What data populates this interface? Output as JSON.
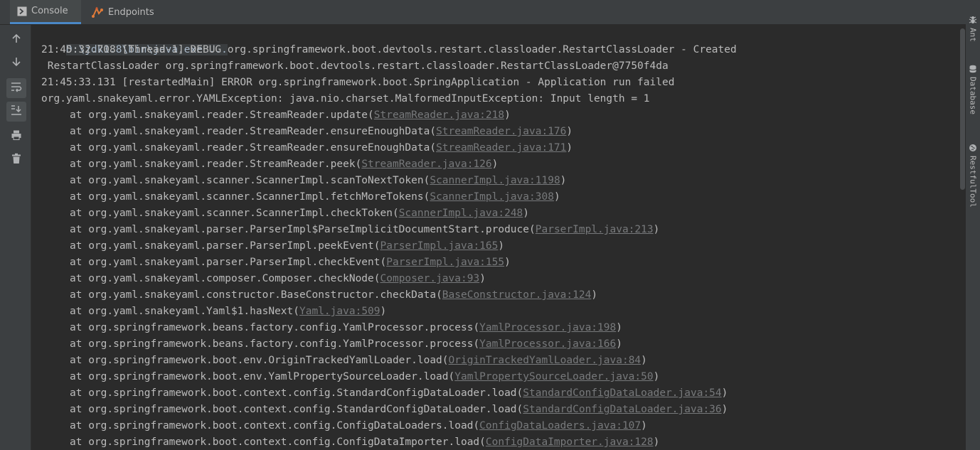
{
  "tabs": [
    {
      "label": "Console",
      "icon": "console-icon",
      "active": true
    },
    {
      "label": "Endpoints",
      "icon": "endpoints-icon",
      "active": false
    }
  ],
  "toolbar": [
    {
      "icon": "arrow-up-icon",
      "title": "Up the Stack Trace"
    },
    {
      "icon": "arrow-down-icon",
      "title": "Down the Stack Trace"
    },
    {
      "icon": "soft-wrap-icon",
      "title": "Soft-Wrap"
    },
    {
      "icon": "scroll-to-end-icon",
      "title": "Scroll to the End"
    },
    {
      "icon": "print-icon",
      "title": "Print"
    },
    {
      "icon": "trash-icon",
      "title": "Clear All"
    }
  ],
  "right_tools": [
    {
      "label": "Ant",
      "icon": "ant-icon"
    },
    {
      "label": "Database",
      "icon": "database-icon"
    },
    {
      "label": "RestfulTool",
      "icon": "globe-icon"
    }
  ],
  "console": {
    "command": "D:\\jdk1.8\\bin\\java.exe ...",
    "lines": [
      "21:45:32.708 [Thread-1] DEBUG org.springframework.boot.devtools.restart.classloader.RestartClassLoader - Created",
      " RestartClassLoader org.springframework.boot.devtools.restart.classloader.RestartClassLoader@7750f4da",
      "21:45:33.131 [restartedMain] ERROR org.springframework.boot.SpringApplication - Application run failed",
      "org.yaml.snakeyaml.error.YAMLException: java.nio.charset.MalformedInputException: Input length = 1"
    ],
    "frames": [
      {
        "method": "at org.yaml.snakeyaml.reader.StreamReader.update",
        "link": "StreamReader.java:218"
      },
      {
        "method": "at org.yaml.snakeyaml.reader.StreamReader.ensureEnoughData",
        "link": "StreamReader.java:176"
      },
      {
        "method": "at org.yaml.snakeyaml.reader.StreamReader.ensureEnoughData",
        "link": "StreamReader.java:171"
      },
      {
        "method": "at org.yaml.snakeyaml.reader.StreamReader.peek",
        "link": "StreamReader.java:126"
      },
      {
        "method": "at org.yaml.snakeyaml.scanner.ScannerImpl.scanToNextToken",
        "link": "ScannerImpl.java:1198"
      },
      {
        "method": "at org.yaml.snakeyaml.scanner.ScannerImpl.fetchMoreTokens",
        "link": "ScannerImpl.java:308"
      },
      {
        "method": "at org.yaml.snakeyaml.scanner.ScannerImpl.checkToken",
        "link": "ScannerImpl.java:248"
      },
      {
        "method": "at org.yaml.snakeyaml.parser.ParserImpl$ParseImplicitDocumentStart.produce",
        "link": "ParserImpl.java:213"
      },
      {
        "method": "at org.yaml.snakeyaml.parser.ParserImpl.peekEvent",
        "link": "ParserImpl.java:165"
      },
      {
        "method": "at org.yaml.snakeyaml.parser.ParserImpl.checkEvent",
        "link": "ParserImpl.java:155"
      },
      {
        "method": "at org.yaml.snakeyaml.composer.Composer.checkNode",
        "link": "Composer.java:93"
      },
      {
        "method": "at org.yaml.snakeyaml.constructor.BaseConstructor.checkData",
        "link": "BaseConstructor.java:124"
      },
      {
        "method": "at org.yaml.snakeyaml.Yaml$1.hasNext",
        "link": "Yaml.java:509"
      },
      {
        "method": "at org.springframework.beans.factory.config.YamlProcessor.process",
        "link": "YamlProcessor.java:198"
      },
      {
        "method": "at org.springframework.beans.factory.config.YamlProcessor.process",
        "link": "YamlProcessor.java:166"
      },
      {
        "method": "at org.springframework.boot.env.OriginTrackedYamlLoader.load",
        "link": "OriginTrackedYamlLoader.java:84"
      },
      {
        "method": "at org.springframework.boot.env.YamlPropertySourceLoader.load",
        "link": "YamlPropertySourceLoader.java:50"
      },
      {
        "method": "at org.springframework.boot.context.config.StandardConfigDataLoader.load",
        "link": "StandardConfigDataLoader.java:54"
      },
      {
        "method": "at org.springframework.boot.context.config.StandardConfigDataLoader.load",
        "link": "StandardConfigDataLoader.java:36"
      },
      {
        "method": "at org.springframework.boot.context.config.ConfigDataLoaders.load",
        "link": "ConfigDataLoaders.java:107"
      },
      {
        "method": "at org.springframework.boot.context.config.ConfigDataImporter.load",
        "link": "ConfigDataImporter.java:128"
      }
    ]
  },
  "colors": {
    "background": "#2b2b2b",
    "panel": "#3c3f41",
    "text": "#bbbbbb",
    "link": "#77797b",
    "accent": "#4a88c7"
  }
}
